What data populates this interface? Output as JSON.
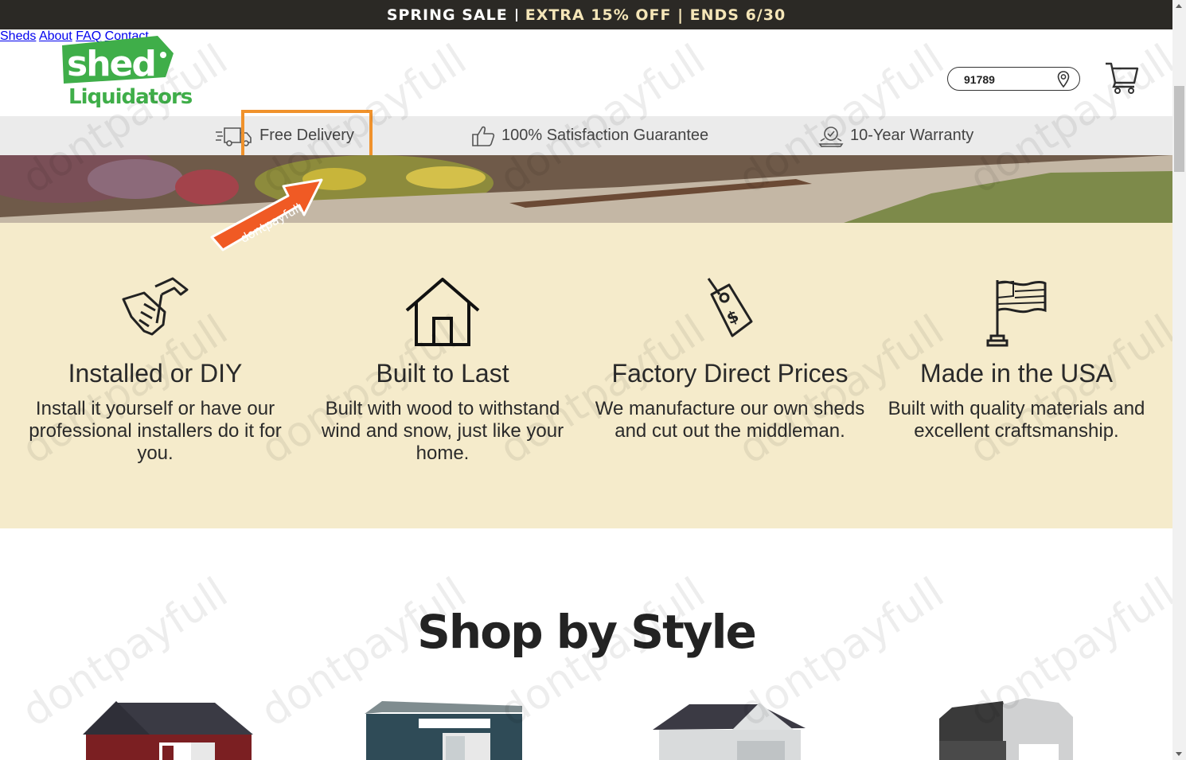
{
  "promo": {
    "part1": "SPRING SALE",
    "part2": "EXTRA 15% OFF | ENDS 6/30"
  },
  "logo": {
    "word1": "shed",
    "word2": "Liquidators"
  },
  "nav": [
    "Sheds",
    "About",
    "FAQ",
    "Contact"
  ],
  "zip": {
    "value": "91789"
  },
  "benefits": [
    {
      "icon": "delivery-truck-icon",
      "label": "Free Delivery"
    },
    {
      "icon": "thumbs-up-icon",
      "label": "100% Satisfaction Guarantee"
    },
    {
      "icon": "warranty-badge-icon",
      "label": "10-Year Warranty"
    }
  ],
  "watermark_text": "dontpayfull",
  "features": [
    {
      "icon": "hammer-hand-icon",
      "title": "Installed or DIY",
      "text": "Install it yourself or have our professional installers do it for you."
    },
    {
      "icon": "house-icon",
      "title": "Built to Last",
      "text": "Built with wood to withstand wind and snow, just like your home."
    },
    {
      "icon": "price-tag-icon",
      "title": "Factory Direct Prices",
      "text": "We manufacture our own sheds and cut out the middleman."
    },
    {
      "icon": "usa-flag-icon",
      "title": "Made in the USA",
      "text": "Built with quality materials and excellent craftsmanship."
    }
  ],
  "shop": {
    "title": "Shop by Style"
  },
  "colors": {
    "brand_green": "#3fae49",
    "promo_bg": "#2b2925",
    "feature_bg": "#f5ebcb",
    "highlight": "#f0922c"
  }
}
